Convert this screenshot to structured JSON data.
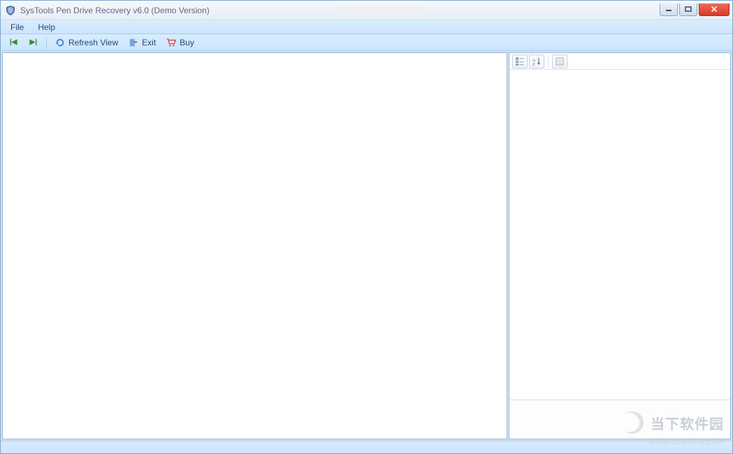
{
  "titlebar": {
    "title": "SysTools Pen Drive Recovery v6.0 (Demo Version)"
  },
  "menu": {
    "file": "File",
    "help": "Help"
  },
  "toolbar": {
    "refresh_label": "Refresh View",
    "exit_label": "Exit",
    "buy_label": "Buy"
  },
  "watermark": {
    "brand": "当下软件园",
    "url": "www.downxia.com"
  }
}
